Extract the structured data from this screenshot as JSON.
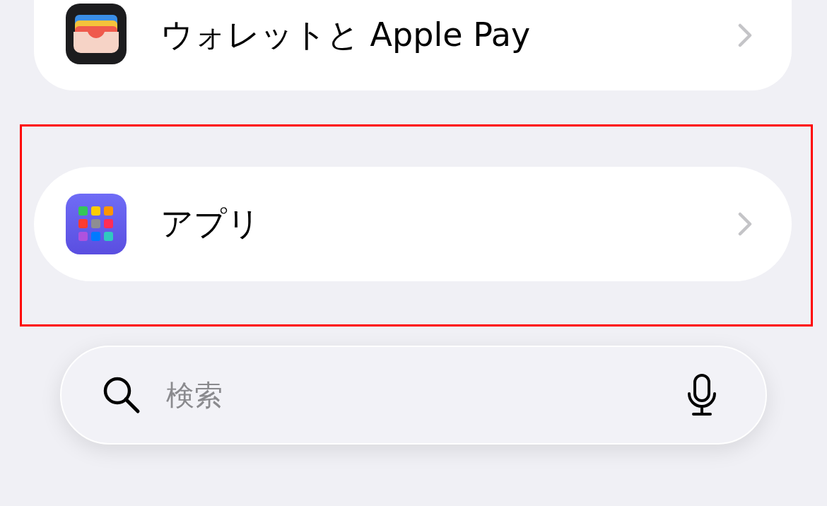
{
  "settings_rows": [
    {
      "kind": "wallet",
      "label": "ウォレットと Apple Pay",
      "highlighted": false,
      "cut_top": true
    },
    {
      "kind": "apps",
      "label": "アプリ",
      "highlighted": true,
      "cut_top": false
    }
  ],
  "search": {
    "placeholder": "検索"
  }
}
